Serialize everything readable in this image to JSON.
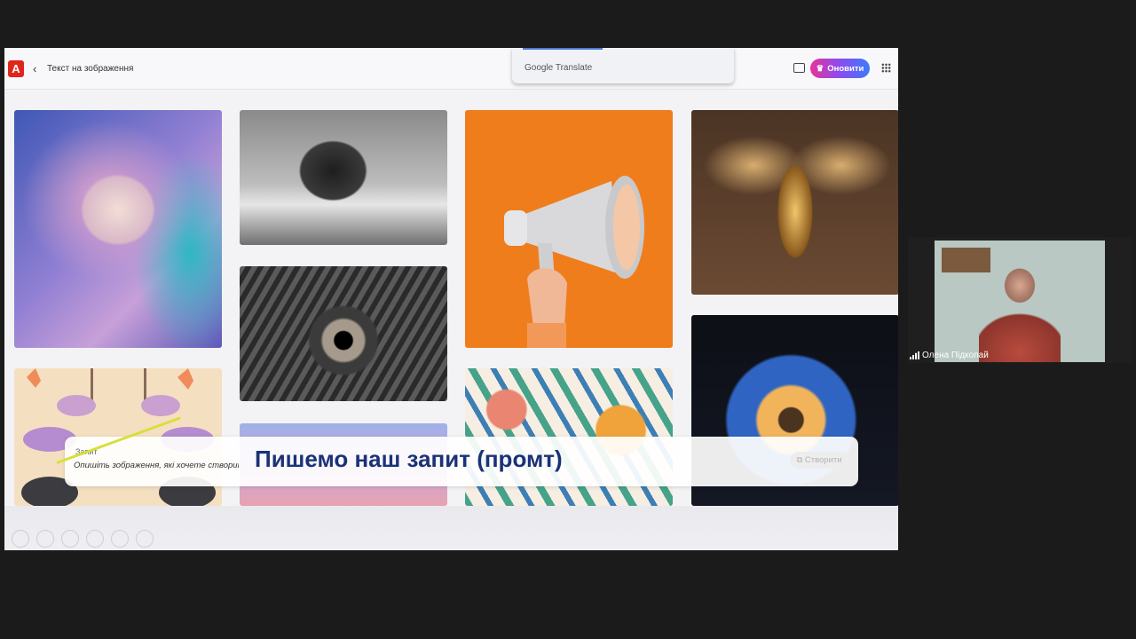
{
  "header": {
    "logo_label": "A",
    "back_icon": "chevron-left-icon",
    "breadcrumb": "Текст на зображення",
    "upgrade_label": "Оновити",
    "upgrade_icon": "crown-icon",
    "comment_icon": "comment-icon",
    "apps_icon": "apps-grid-icon"
  },
  "translate_popup": {
    "label": "Google Translate"
  },
  "gallery": {
    "tiles": [
      "lion",
      "mammoth",
      "dragon-eye",
      "blue-pink",
      "megaphone",
      "leaves-flowers",
      "golden-bee",
      "blue-flower",
      "abstract"
    ]
  },
  "prompt": {
    "label": "Запит",
    "placeholder": "Опишіть зображення, які хочете створити",
    "create_label": "Створити"
  },
  "caption": "Пишемо наш запит (промт)",
  "video": {
    "participant_name": "Олена Підкопай"
  },
  "colors": {
    "accent_adobe": "#e1251b",
    "caption": "#1a3277",
    "megaphone_bg": "#f07d1c"
  }
}
